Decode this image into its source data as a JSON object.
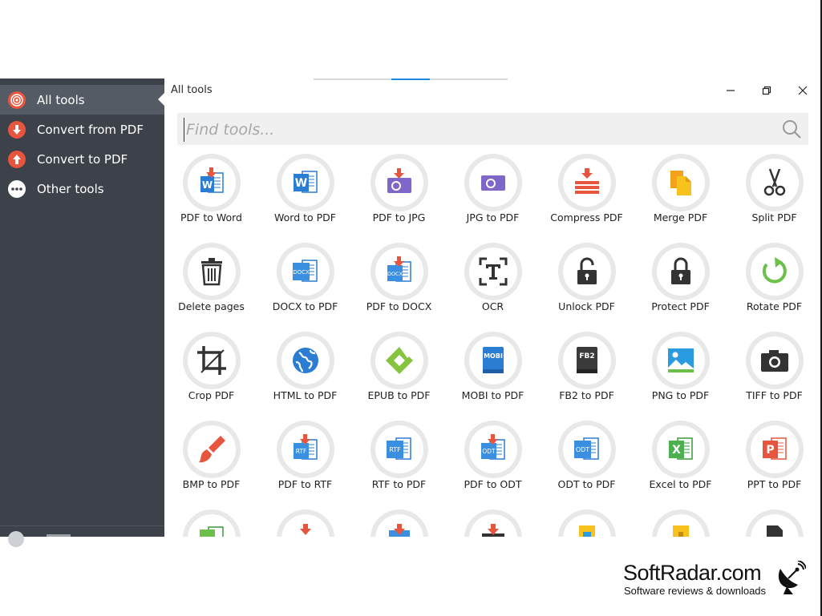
{
  "window": {
    "title": "All tools"
  },
  "sidebar": {
    "items": [
      {
        "label": "All tools",
        "icon": "target-icon",
        "color": "#e8553e",
        "active": true
      },
      {
        "label": "Convert from PDF",
        "icon": "arrow-down-icon",
        "color": "#e8553e",
        "active": false
      },
      {
        "label": "Convert to PDF",
        "icon": "arrow-up-icon",
        "color": "#e8553e",
        "active": false
      },
      {
        "label": "Other tools",
        "icon": "ellipsis-icon",
        "color": "#ffffff",
        "active": false
      }
    ]
  },
  "search": {
    "placeholder": "Find tools..."
  },
  "tools": [
    {
      "label": "PDF to Word"
    },
    {
      "label": "Word to PDF"
    },
    {
      "label": "PDF to JPG"
    },
    {
      "label": "JPG to PDF"
    },
    {
      "label": "Compress PDF"
    },
    {
      "label": "Merge PDF"
    },
    {
      "label": "Split PDF"
    },
    {
      "label": "Delete pages"
    },
    {
      "label": "DOCX to PDF"
    },
    {
      "label": "PDF to DOCX"
    },
    {
      "label": "OCR"
    },
    {
      "label": "Unlock PDF"
    },
    {
      "label": "Protect PDF"
    },
    {
      "label": "Rotate PDF"
    },
    {
      "label": "Crop PDF"
    },
    {
      "label": "HTML to PDF"
    },
    {
      "label": "EPUB to PDF"
    },
    {
      "label": "MOBI to PDF"
    },
    {
      "label": "FB2 to PDF"
    },
    {
      "label": "PNG to PDF"
    },
    {
      "label": "TIFF to PDF"
    },
    {
      "label": "BMP to PDF"
    },
    {
      "label": "PDF to RTF"
    },
    {
      "label": "RTF to PDF"
    },
    {
      "label": "PDF to ODT"
    },
    {
      "label": "ODT to PDF"
    },
    {
      "label": "Excel to PDF"
    },
    {
      "label": "PPT to PDF"
    }
  ],
  "icon_text": {
    "docx": "DOCX",
    "rtf": "RTF",
    "odt": "ODT",
    "mobi": "MOBI",
    "fb2": "FB2",
    "word": "W",
    "excel": "X",
    "ppt": "P"
  },
  "watermark": {
    "title": "SoftRadar.com",
    "subtitle": "Software reviews & downloads"
  },
  "colors": {
    "accent_red": "#e8553e",
    "accent_blue": "#1e88e5",
    "sidebar_bg": "#3c414a",
    "ring": "#e8e8e8"
  }
}
